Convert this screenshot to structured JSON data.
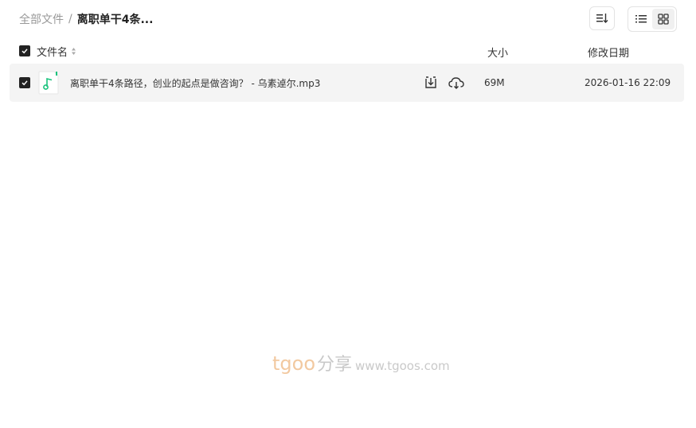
{
  "breadcrumb": {
    "root": "全部文件",
    "separator": "/",
    "current": "离职单干4条..."
  },
  "toolbar": {
    "sort_icon": "sort-icon",
    "list_view_icon": "list-view-icon",
    "grid_view_icon": "grid-view-icon"
  },
  "table": {
    "headers": {
      "name": "文件名",
      "size": "大小",
      "date": "修改日期"
    },
    "rows": [
      {
        "name": "离职单干4条路径，创业的起点是做咨询？ - 乌素逴尔.mp3",
        "size": "69M",
        "date": "2026-01-16 22:09",
        "icon": "audio-file-icon"
      }
    ]
  },
  "watermark": {
    "brand": "tgoo",
    "cn": "分享",
    "url": "www.tgoos.com"
  },
  "colors": {
    "accent_green": "#19c37d",
    "checkbox": "#222222",
    "row_bg": "#f4f4f4",
    "watermark_brand": "#f2c9a0"
  }
}
